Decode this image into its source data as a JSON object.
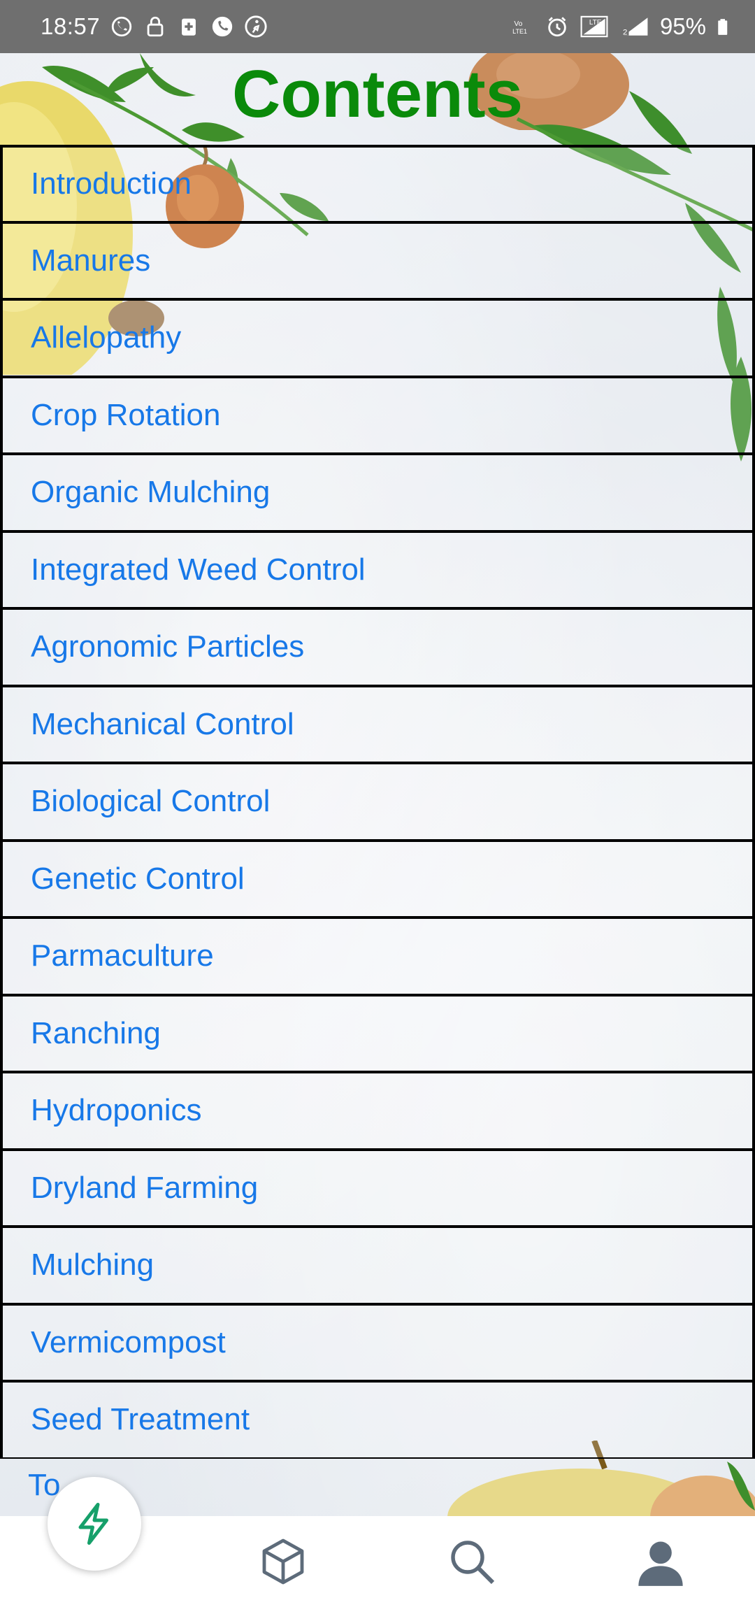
{
  "status_bar": {
    "time": "18:57",
    "battery": "95%",
    "left_icons": [
      "whatsapp-icon",
      "lock-icon",
      "medical-icon",
      "phone-icon",
      "fitness-icon"
    ],
    "right_icons": [
      "volte-icon",
      "alarm-icon",
      "signal-lte-sim1-icon",
      "signal-sim2-icon",
      "battery-icon"
    ],
    "volte_label": "Vo LTE1"
  },
  "page": {
    "title": "Contents"
  },
  "topics": [
    {
      "label": "Introduction"
    },
    {
      "label": "Manures"
    },
    {
      "label": "Allelopathy"
    },
    {
      "label": "Crop Rotation"
    },
    {
      "label": "Organic Mulching"
    },
    {
      "label": "Integrated Weed Control"
    },
    {
      "label": "Agronomic Particles"
    },
    {
      "label": "Mechanical Control"
    },
    {
      "label": "Biological Control"
    },
    {
      "label": "Genetic Control"
    },
    {
      "label": "Parmaculture"
    },
    {
      "label": "Ranching"
    },
    {
      "label": "Hydroponics"
    },
    {
      "label": "Dryland Farming"
    },
    {
      "label": "Mulching"
    },
    {
      "label": "Vermicompost"
    },
    {
      "label": "Seed Treatment"
    }
  ],
  "partial_topic": {
    "label": "To...o"
  },
  "bottom_nav": {
    "items": [
      "flash-icon",
      "cube-icon",
      "search-icon",
      "profile-icon"
    ]
  },
  "colors": {
    "title": "#0a8a0a",
    "link": "#1778e8",
    "status_bar": "#6f6f6f",
    "border": "#000000"
  }
}
